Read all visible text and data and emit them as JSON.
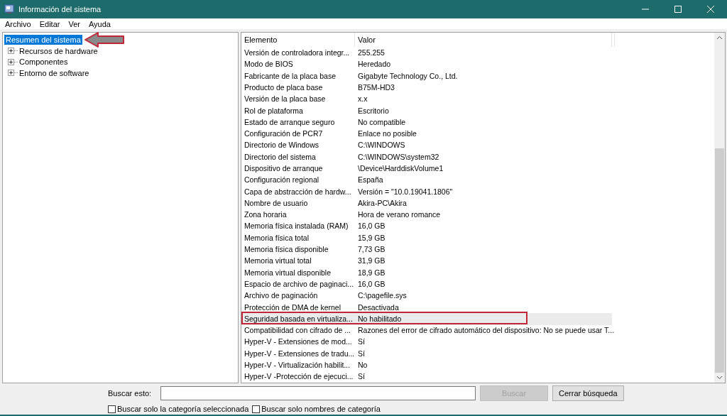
{
  "window": {
    "title": "Información del sistema"
  },
  "menu": [
    "Archivo",
    "Editar",
    "Ver",
    "Ayuda"
  ],
  "tree": [
    {
      "label": "Resumen del sistema",
      "selected": true,
      "annotated": true
    },
    {
      "label": "Recursos de hardware",
      "selected": false,
      "expanded": false,
      "annotated": false
    },
    {
      "label": "Componentes",
      "selected": false,
      "expanded": false,
      "annotated": false
    },
    {
      "label": "Entorno de software",
      "selected": false,
      "expanded": false,
      "annotated": false
    }
  ],
  "table": {
    "columns": [
      "Elemento",
      "Valor"
    ],
    "rows": [
      {
        "cells": [
          "Versión de controladora integr...",
          "255.255"
        ],
        "selected": false,
        "highlighted": false
      },
      {
        "cells": [
          "Modo de BIOS",
          "Heredado"
        ],
        "selected": false,
        "highlighted": false
      },
      {
        "cells": [
          "Fabricante de la placa base",
          "Gigabyte Technology Co., Ltd."
        ],
        "selected": false,
        "highlighted": false
      },
      {
        "cells": [
          "Producto de placa base",
          "B75M-HD3"
        ],
        "selected": false,
        "highlighted": false
      },
      {
        "cells": [
          "Versión de la placa base",
          "x.x"
        ],
        "selected": false,
        "highlighted": false
      },
      {
        "cells": [
          "Rol de plataforma",
          "Escritorio"
        ],
        "selected": false,
        "highlighted": false
      },
      {
        "cells": [
          "Estado de arranque seguro",
          "No compatible"
        ],
        "selected": false,
        "highlighted": false
      },
      {
        "cells": [
          "Configuración de PCR7",
          "Enlace no posible"
        ],
        "selected": false,
        "highlighted": false
      },
      {
        "cells": [
          "Directorio de Windows",
          "C:\\WINDOWS"
        ],
        "selected": false,
        "highlighted": false
      },
      {
        "cells": [
          "Directorio del sistema",
          "C:\\WINDOWS\\system32"
        ],
        "selected": false,
        "highlighted": false
      },
      {
        "cells": [
          "Dispositivo de arranque",
          "\\Device\\HarddiskVolume1"
        ],
        "selected": false,
        "highlighted": false
      },
      {
        "cells": [
          "Configuración regional",
          "España"
        ],
        "selected": false,
        "highlighted": false
      },
      {
        "cells": [
          "Capa de abstracción de hardw...",
          "Versión = \"10.0.19041.1806\""
        ],
        "selected": false,
        "highlighted": false
      },
      {
        "cells": [
          "Nombre de usuario",
          "Akira-PC\\Akira"
        ],
        "selected": false,
        "highlighted": false
      },
      {
        "cells": [
          "Zona horaria",
          "Hora de verano romance"
        ],
        "selected": false,
        "highlighted": false
      },
      {
        "cells": [
          "Memoria física instalada (RAM)",
          "16,0 GB"
        ],
        "selected": false,
        "highlighted": false
      },
      {
        "cells": [
          "Memoria física total",
          "15,9 GB"
        ],
        "selected": false,
        "highlighted": false
      },
      {
        "cells": [
          "Memoria física disponible",
          "7,73 GB"
        ],
        "selected": false,
        "highlighted": false
      },
      {
        "cells": [
          "Memoria virtual total",
          "31,9 GB"
        ],
        "selected": false,
        "highlighted": false
      },
      {
        "cells": [
          "Memoria virtual disponible",
          "18,9 GB"
        ],
        "selected": false,
        "highlighted": false
      },
      {
        "cells": [
          "Espacio de archivo de paginaci...",
          "16,0 GB"
        ],
        "selected": false,
        "highlighted": false
      },
      {
        "cells": [
          "Archivo de paginación",
          "C:\\pagefile.sys"
        ],
        "selected": false,
        "highlighted": false
      },
      {
        "cells": [
          "Protección de DMA de kernel",
          "Desactivada"
        ],
        "selected": false,
        "highlighted": false
      },
      {
        "cells": [
          "Seguridad basada en virtualiza...",
          "No habilitado"
        ],
        "selected": true,
        "highlighted": true
      },
      {
        "cells": [
          "Compatibilidad con cifrado de ...",
          "Razones del error de cifrado automático del dispositivo: No se puede usar T..."
        ],
        "selected": false,
        "highlighted": false
      },
      {
        "cells": [
          "Hyper-V - Extensiones de mod...",
          "Sí"
        ],
        "selected": false,
        "highlighted": false
      },
      {
        "cells": [
          "Hyper-V - Extensiones de tradu...",
          "Sí"
        ],
        "selected": false,
        "highlighted": false
      },
      {
        "cells": [
          "Hyper-V - Virtualización habilit...",
          "No"
        ],
        "selected": false,
        "highlighted": false
      },
      {
        "cells": [
          "Hyper-V -Protección de ejecuci...",
          "Sí"
        ],
        "selected": false,
        "highlighted": false
      }
    ]
  },
  "search": {
    "label": "Buscar esto:",
    "buttons": [
      {
        "label": "Buscar",
        "disabled": true
      },
      {
        "label": "Cerrar búsqueda",
        "disabled": false
      }
    ],
    "options": [
      {
        "label": "Buscar solo la categoría seleccionada",
        "checked": false
      },
      {
        "label": "Buscar solo nombres de categoría",
        "checked": false
      }
    ]
  }
}
